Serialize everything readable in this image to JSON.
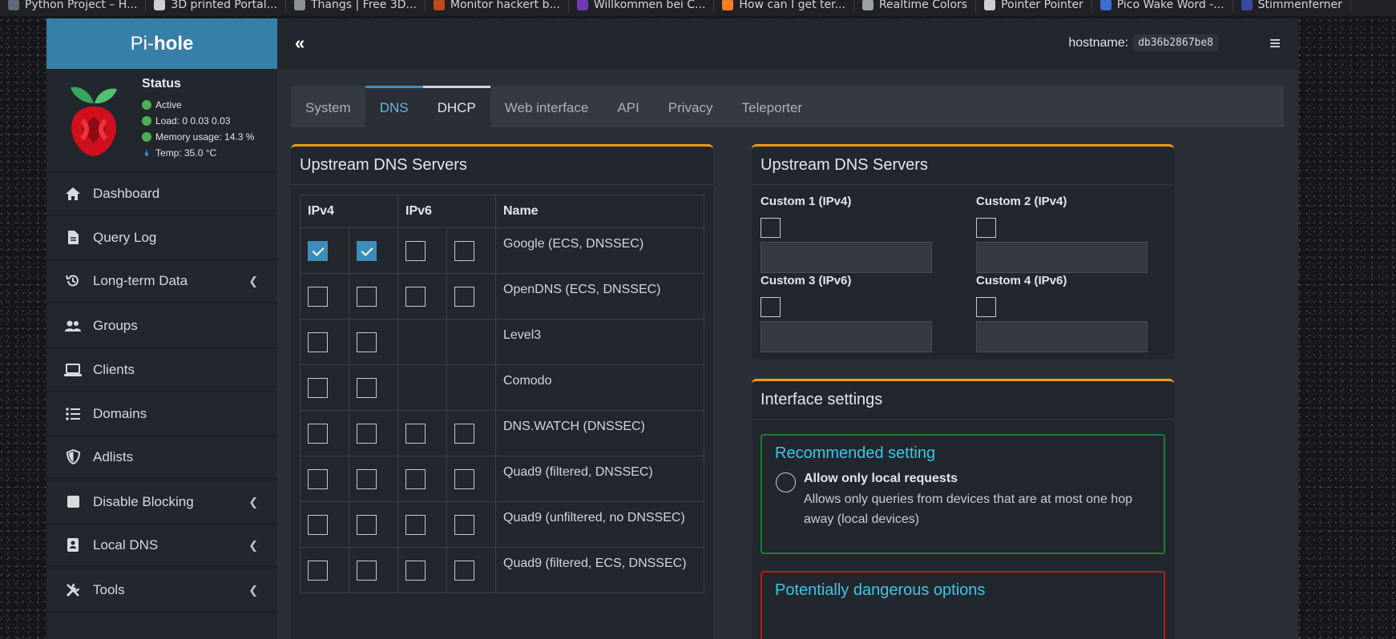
{
  "bookmarks": [
    {
      "label": "Python Project – H...",
      "color": "#5f6b7a"
    },
    {
      "label": "3D printed Portal...",
      "color": "#cfcfcf"
    },
    {
      "label": "Thangs | Free 3D...",
      "color": "#8a8f98"
    },
    {
      "label": "Monitor hackert b...",
      "color": "#c14a1d"
    },
    {
      "label": "Willkommen bei C...",
      "color": "#6f3bb5"
    },
    {
      "label": "How can I get ter...",
      "color": "#f48024"
    },
    {
      "label": "Realtime Colors",
      "color": "#9aa0a6"
    },
    {
      "label": "Pointer Pointer",
      "color": "#cfcfcf"
    },
    {
      "label": "Pico Wake Word -...",
      "color": "#3b6fd1"
    },
    {
      "label": "Stimmenferner",
      "color": "#3a4aa1"
    }
  ],
  "brand": {
    "prefix": "Pi-",
    "name": "hole"
  },
  "status": {
    "title": "Status",
    "active": "Active",
    "load": "Load:  0  0.03  0.03",
    "memory": "Memory usage:  14.3 %",
    "temp": "Temp: 35.0 °C",
    "dot_color": "#4caf50"
  },
  "menu": [
    {
      "label": "Dashboard",
      "icon": "home-icon",
      "has_submenu": false
    },
    {
      "label": "Query Log",
      "icon": "file-icon",
      "has_submenu": false
    },
    {
      "label": "Long-term Data",
      "icon": "history-icon",
      "has_submenu": true
    },
    {
      "label": "Groups",
      "icon": "users-icon",
      "has_submenu": false
    },
    {
      "label": "Clients",
      "icon": "laptop-icon",
      "has_submenu": false
    },
    {
      "label": "Domains",
      "icon": "list-icon",
      "has_submenu": false
    },
    {
      "label": "Adlists",
      "icon": "shield-icon",
      "has_submenu": false
    },
    {
      "label": "Disable Blocking",
      "icon": "stop-icon",
      "has_submenu": true
    },
    {
      "label": "Local DNS",
      "icon": "address-book-icon",
      "has_submenu": true
    },
    {
      "label": "Tools",
      "icon": "tools-icon",
      "has_submenu": true
    }
  ],
  "topbar": {
    "collapse_glyph": "«",
    "hostname_label": "hostname:",
    "hostname_value": "db36b2867be8",
    "menu_glyph": "≡"
  },
  "tabs": [
    {
      "label": "System",
      "state": "normal"
    },
    {
      "label": "DNS",
      "state": "active"
    },
    {
      "label": "DHCP",
      "state": "hover"
    },
    {
      "label": "Web interface",
      "state": "normal"
    },
    {
      "label": "API",
      "state": "normal"
    },
    {
      "label": "Privacy",
      "state": "normal"
    },
    {
      "label": "Teleporter",
      "state": "normal"
    }
  ],
  "upstream": {
    "title": "Upstream DNS Servers",
    "headers": {
      "ipv4": "IPv4",
      "ipv6": "IPv6",
      "name": "Name"
    },
    "rows": [
      {
        "name": "Google (ECS, DNSSEC)",
        "v4": [
          true,
          true
        ],
        "v6": [
          false,
          false
        ]
      },
      {
        "name": "OpenDNS (ECS, DNSSEC)",
        "v4": [
          false,
          false
        ],
        "v6": [
          false,
          false
        ]
      },
      {
        "name": "Level3",
        "v4": [
          false,
          false
        ],
        "v6": null
      },
      {
        "name": "Comodo",
        "v4": [
          false,
          false
        ],
        "v6": null
      },
      {
        "name": "DNS.WATCH (DNSSEC)",
        "v4": [
          false,
          false
        ],
        "v6": [
          false,
          false
        ]
      },
      {
        "name": "Quad9 (filtered, DNSSEC)",
        "v4": [
          false,
          false
        ],
        "v6": [
          false,
          false
        ]
      },
      {
        "name": "Quad9 (unfiltered, no DNSSEC)",
        "v4": [
          false,
          false
        ],
        "v6": [
          false,
          false
        ]
      },
      {
        "name": "Quad9 (filtered, ECS, DNSSEC)",
        "v4": [
          false,
          false
        ],
        "v6": [
          false,
          false
        ]
      }
    ]
  },
  "custom": {
    "title": "Upstream DNS Servers",
    "items": [
      {
        "label": "Custom 1 (IPv4)",
        "checked": false,
        "value": ""
      },
      {
        "label": "Custom 2 (IPv4)",
        "checked": false,
        "value": ""
      },
      {
        "label": "Custom 3 (IPv6)",
        "checked": false,
        "value": ""
      },
      {
        "label": "Custom 4 (IPv6)",
        "checked": false,
        "value": ""
      }
    ]
  },
  "interface": {
    "title": "Interface settings",
    "recommended": {
      "title": "Recommended setting",
      "option": "Allow only local requests",
      "desc": "Allows only queries from devices that are at most one hop away (local devices)"
    },
    "dangerous": {
      "title": "Potentially dangerous options"
    }
  },
  "colors": {
    "accent": "#3c8dbc",
    "box_border": "#f39c12",
    "brand": "#367fa9",
    "heading_cyan": "#39c6e6"
  }
}
